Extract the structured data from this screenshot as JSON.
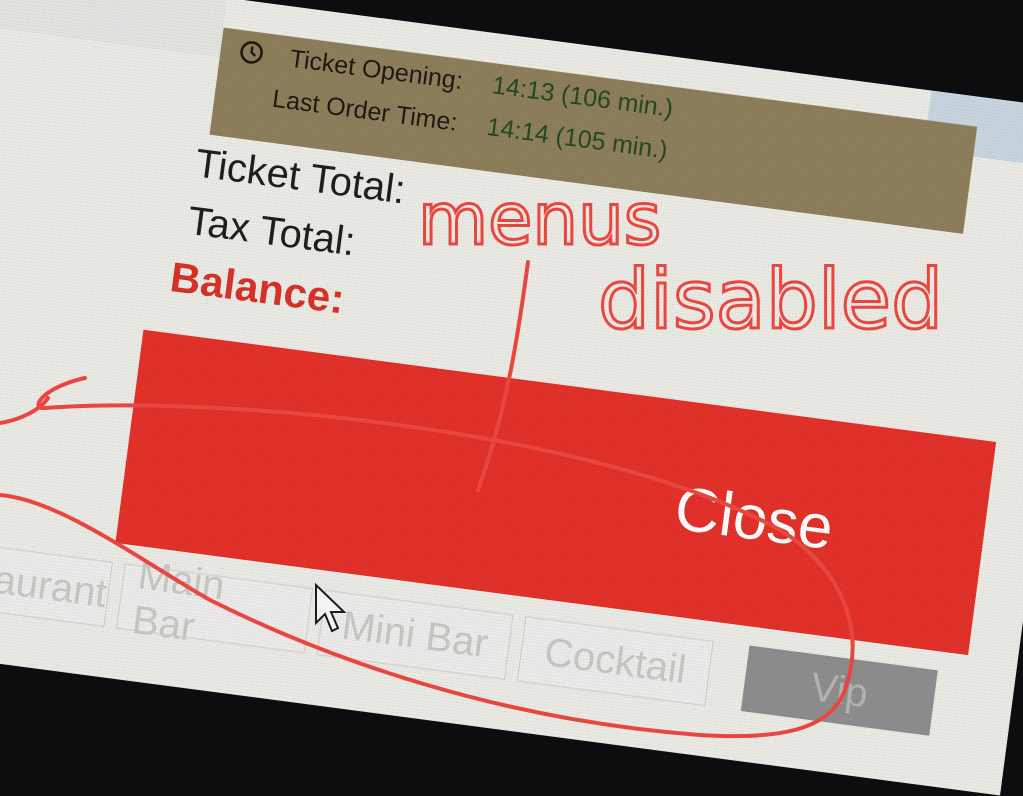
{
  "ticket_info": {
    "opening_label": "Ticket Opening:",
    "opening_value": "14:13 (106 min.)",
    "last_order_label": "Last Order Time:",
    "last_order_value": "14:14 (105 min.)"
  },
  "totals": {
    "ticket_total_label": "Ticket Total:",
    "tax_total_label": "Tax Total:",
    "balance_label": "Balance:"
  },
  "close_button": {
    "label": "Close"
  },
  "menu_tabs": [
    {
      "label": "Restaurant",
      "enabled": false
    },
    {
      "label": "Main Bar",
      "enabled": false
    },
    {
      "label": "Mini Bar",
      "enabled": false
    },
    {
      "label": "Cocktail",
      "enabled": false
    },
    {
      "label": "Vip",
      "enabled": true
    }
  ],
  "annotation": {
    "text_line1": "menus",
    "text_line2": "disabled",
    "color": "#e8473f"
  },
  "icons": {
    "clock": "clock-icon",
    "cursor": "mouse-cursor-icon"
  },
  "colors": {
    "accent_red": "#e4312a",
    "panel": "#8e7f5c"
  }
}
